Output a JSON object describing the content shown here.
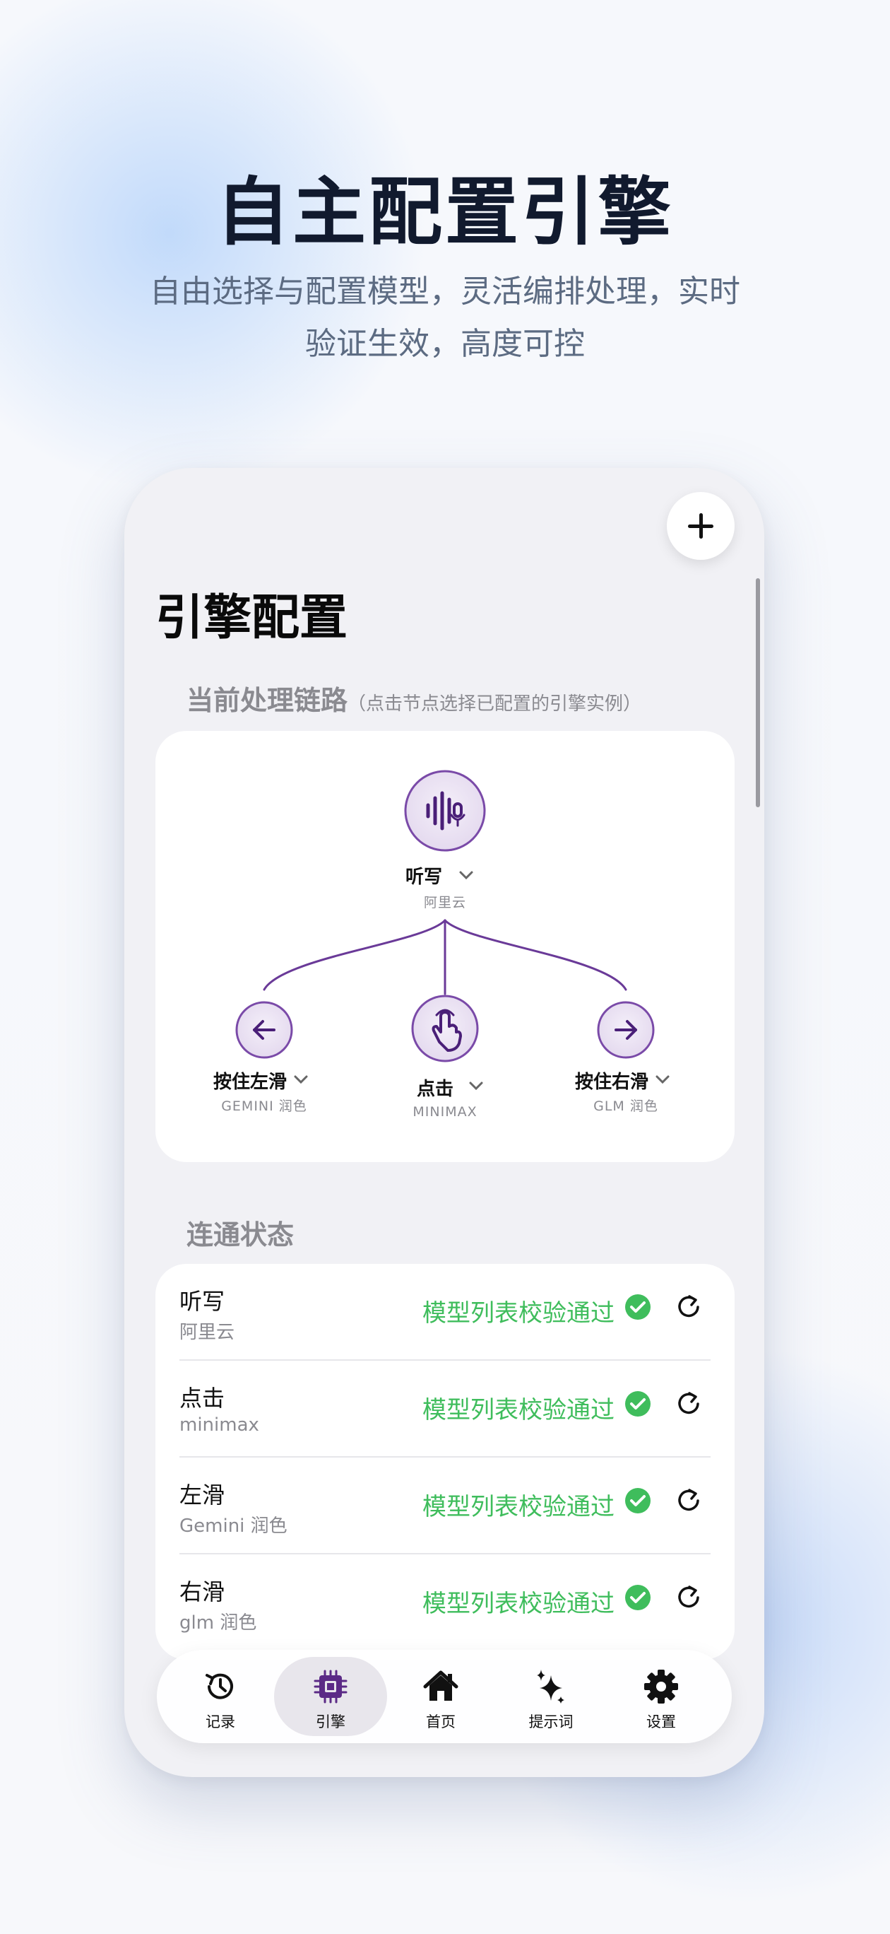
{
  "hero": {
    "title": "自主配置引擎",
    "subtitle_line1": "自由选择与配置模型，灵活编排处理，实时",
    "subtitle_line2": "验证生效，高度可控"
  },
  "page": {
    "title": "引擎配置",
    "chain_section_label": "当前处理链路",
    "chain_section_hint": "（点击节点选择已配置的引擎实例）",
    "status_section_label": "连通状态"
  },
  "chain": {
    "root": {
      "label": "听写",
      "sub": "阿里云",
      "icon": "waveform-mic-icon"
    },
    "left": {
      "label": "按住左滑",
      "sub": "GEMINI 润色",
      "icon": "arrow-left-icon"
    },
    "center": {
      "label": "点击",
      "sub": "MINIMAX",
      "icon": "tap-hand-icon"
    },
    "right": {
      "label": "按住右滑",
      "sub": "GLM 润色",
      "icon": "arrow-right-icon"
    }
  },
  "status": {
    "rows": [
      {
        "name": "听写",
        "sub": "阿里云",
        "status": "模型列表校验通过"
      },
      {
        "name": "点击",
        "sub": "minimax",
        "status": "模型列表校验通过"
      },
      {
        "name": "左滑",
        "sub": "Gemini 润色",
        "status": "模型列表校验通过"
      },
      {
        "name": "右滑",
        "sub": "glm 润色",
        "status": "模型列表校验通过"
      }
    ]
  },
  "tabs": [
    {
      "label": "记录",
      "icon": "history-icon"
    },
    {
      "label": "引擎",
      "icon": "chip-icon",
      "active": true
    },
    {
      "label": "首页",
      "icon": "home-icon"
    },
    {
      "label": "提示词",
      "icon": "sparkle-icon"
    },
    {
      "label": "设置",
      "icon": "gear-icon"
    }
  ],
  "colors": {
    "accent_purple": "#5b2a86",
    "node_fill": "#ebe4f3",
    "success_green": "#3fbd5c",
    "title_dark": "#111a2e",
    "subtitle_gray": "#5c6b82"
  }
}
